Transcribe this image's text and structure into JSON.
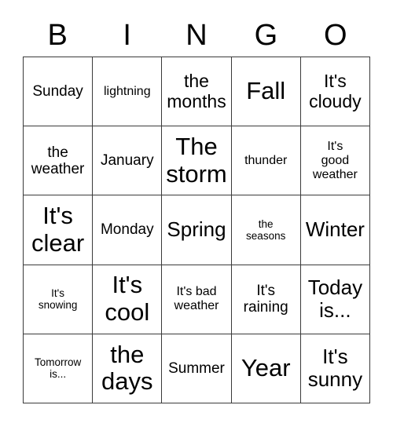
{
  "card": {
    "title": "BINGO",
    "columns": [
      "B",
      "I",
      "N",
      "G",
      "O"
    ],
    "grid_size": "5x5",
    "border_color": "#3a3a3a",
    "background_color": "#ffffff",
    "text_color": "#000000"
  },
  "cells": [
    {
      "text": "Sunday",
      "size": "md"
    },
    {
      "text": "lightning",
      "size": "sm"
    },
    {
      "text": "the\nmonths",
      "size": "lg"
    },
    {
      "text": "Fall",
      "size": "xxl"
    },
    {
      "text": "It's\ncloudy",
      "size": "lg"
    },
    {
      "text": "the\nweather",
      "size": "md"
    },
    {
      "text": "January",
      "size": "md"
    },
    {
      "text": "The\nstorm",
      "size": "xxl"
    },
    {
      "text": "thunder",
      "size": "sm"
    },
    {
      "text": "It's\ngood\nweather",
      "size": "sm"
    },
    {
      "text": "It's\nclear",
      "size": "xxl"
    },
    {
      "text": "Monday",
      "size": "md"
    },
    {
      "text": "Spring",
      "size": "xl"
    },
    {
      "text": "the\nseasons",
      "size": "xs"
    },
    {
      "text": "Winter",
      "size": "xl"
    },
    {
      "text": "It's\nsnowing",
      "size": "xs"
    },
    {
      "text": "It's\ncool",
      "size": "xxl"
    },
    {
      "text": "It's bad\nweather",
      "size": "sm"
    },
    {
      "text": "It's\nraining",
      "size": "md"
    },
    {
      "text": "Today\nis...",
      "size": "xl"
    },
    {
      "text": "Tomorrow\nis...",
      "size": "xs"
    },
    {
      "text": "the\ndays",
      "size": "xxl"
    },
    {
      "text": "Summer",
      "size": "md"
    },
    {
      "text": "Year",
      "size": "xxl"
    },
    {
      "text": "It's\nsunny",
      "size": "xl"
    }
  ]
}
